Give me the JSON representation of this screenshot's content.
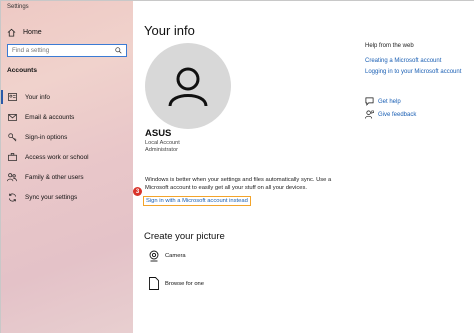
{
  "window": {
    "title": "Settings"
  },
  "sidebar": {
    "home_label": "Home",
    "search_placeholder": "Find a setting",
    "section_title": "Accounts",
    "items": [
      {
        "label": "Your info",
        "icon": "person-card-icon",
        "active": true
      },
      {
        "label": "Email & accounts",
        "icon": "envelope-icon",
        "active": false
      },
      {
        "label": "Sign-in options",
        "icon": "key-icon",
        "active": false
      },
      {
        "label": "Access work or school",
        "icon": "briefcase-icon",
        "active": false
      },
      {
        "label": "Family & other users",
        "icon": "people-icon",
        "active": false
      },
      {
        "label": "Sync your settings",
        "icon": "sync-icon",
        "active": false
      }
    ]
  },
  "main": {
    "title": "Your info",
    "user": {
      "name": "ASUS",
      "account_type": "Local Account",
      "role": "Administrator"
    },
    "info_text": "Windows is better when your settings and files automatically sync. Use a Microsoft account to easily get all your stuff on all your devices.",
    "signin_link": "Sign in with a Microsoft account instead",
    "step_badge": "3",
    "create_picture": {
      "title": "Create your picture",
      "options": [
        {
          "label": "Camera",
          "icon": "camera-icon"
        },
        {
          "label": "Browse for one",
          "icon": "document-icon"
        }
      ]
    }
  },
  "help": {
    "title": "Help from the web",
    "links": [
      "Creating a Microsoft account",
      "Logging in to your Microsoft account"
    ],
    "get_help": "Get help",
    "give_feedback": "Give feedback"
  },
  "colors": {
    "accent": "#2b5aa8",
    "link": "#1a5fb4",
    "highlight_border": "#f3a42a",
    "badge": "#d9342b",
    "avatar_bg": "#d8d8d8"
  }
}
